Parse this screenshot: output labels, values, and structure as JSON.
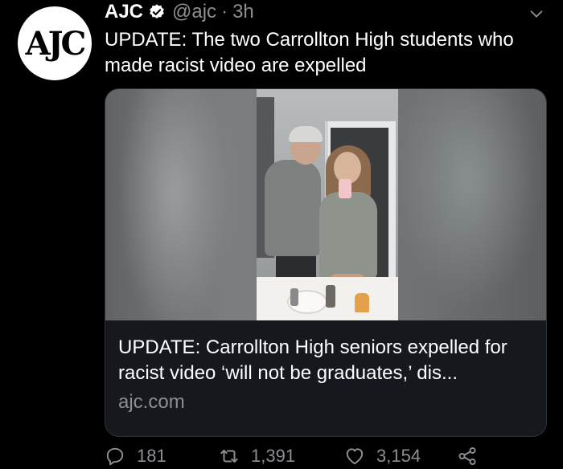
{
  "author": {
    "avatar_text": "AJC",
    "name": "AJC",
    "handle": "@ajc",
    "separator": "·",
    "time": "3h"
  },
  "tweet": {
    "text": "UPDATE: The two Carrollton High students who made racist video are expelled"
  },
  "card": {
    "title": "UPDATE: Carrollton High seniors expelled for racist video ‘will not be graduates,’ dis...",
    "domain": "ajc.com"
  },
  "actions": {
    "replies": "181",
    "retweets": "1,391",
    "likes": "3,154"
  },
  "icons": {
    "verified": "verified-badge-icon",
    "chevron": "chevron-down-icon",
    "reply": "reply-icon",
    "retweet": "retweet-icon",
    "like": "heart-icon",
    "share": "share-icon"
  },
  "colors": {
    "background": "#000000",
    "text": "#ffffff",
    "muted": "#8e8e93",
    "card_border": "#2f3336"
  }
}
